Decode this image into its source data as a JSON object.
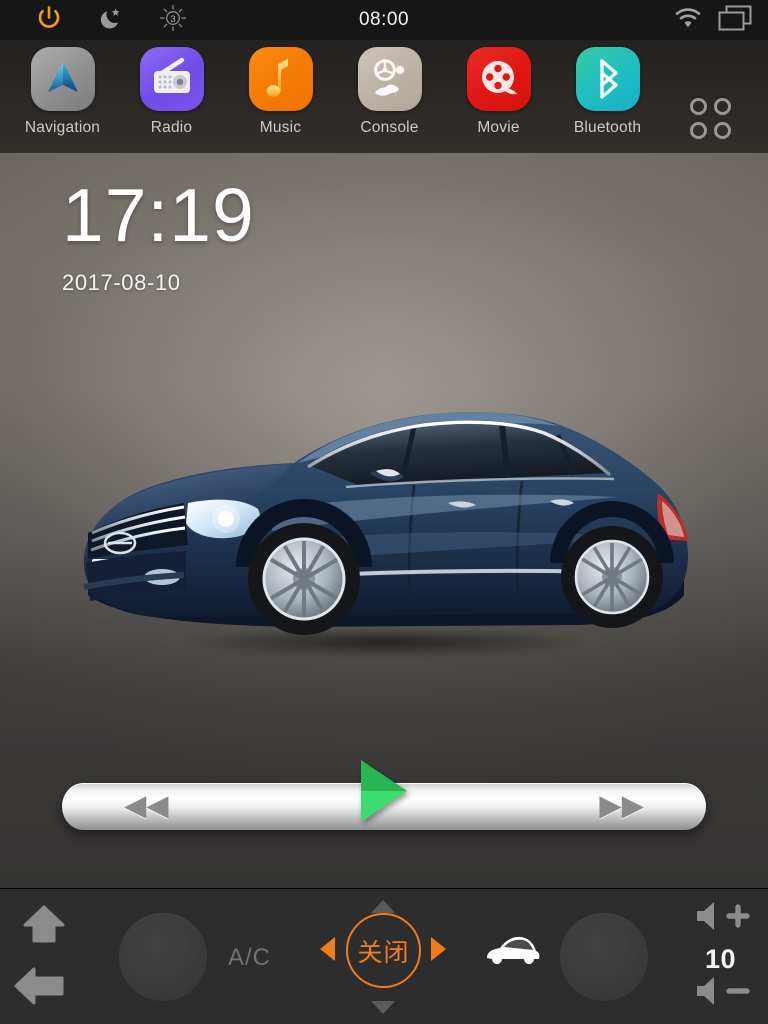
{
  "status_bar": {
    "clock": "08:00",
    "icons": {
      "power": "power-icon",
      "night_mode": "moon-star-icon",
      "brightness": "brightness-icon",
      "brightness_level": "3",
      "wifi": "wifi-icon",
      "multitask": "multitask-window-icon"
    }
  },
  "dock": {
    "apps": [
      {
        "label": "Navigation",
        "icon": "navigation-arrow-icon",
        "color": "#9a9a9a"
      },
      {
        "label": "Radio",
        "icon": "radio-icon",
        "color": "#7a56ec"
      },
      {
        "label": "Music",
        "icon": "music-note-icon",
        "color": "#f47b05"
      },
      {
        "label": "Console",
        "icon": "steering-wheel-icon",
        "color": "#bcb2a4"
      },
      {
        "label": "Movie",
        "icon": "film-reel-icon",
        "color": "#e01714"
      },
      {
        "label": "Bluetooth",
        "icon": "bluetooth-icon",
        "color": "#1fbbc4"
      }
    ],
    "apps_grid": "apps-grid-icon"
  },
  "wallpaper": {
    "clock_time": "17:19",
    "clock_date": "2017-08-10",
    "image": "nissan-altima-sedan-photo"
  },
  "media_bar": {
    "prev_label": "◀◀",
    "next_label": "▶▶",
    "play": "play-icon"
  },
  "control_bar": {
    "home": "home-icon",
    "back": "back-arrow-icon",
    "left_knob": "left-rotary-knob",
    "right_knob": "right-rotary-knob",
    "ac_label": "A/C",
    "mode_value": "关闭",
    "mode_prev": "◀",
    "mode_next": "▶",
    "mode_up": "▲",
    "mode_down": "▼",
    "car_button": "car-icon",
    "volume_value": "10",
    "volume_up": "volume-up-icon",
    "volume_down": "volume-down-icon"
  },
  "colors": {
    "accent_orange": "#ef7c1d",
    "play_green": "#3ddc72",
    "status_bg": "#161616",
    "control_bg": "#2d2d2d"
  }
}
